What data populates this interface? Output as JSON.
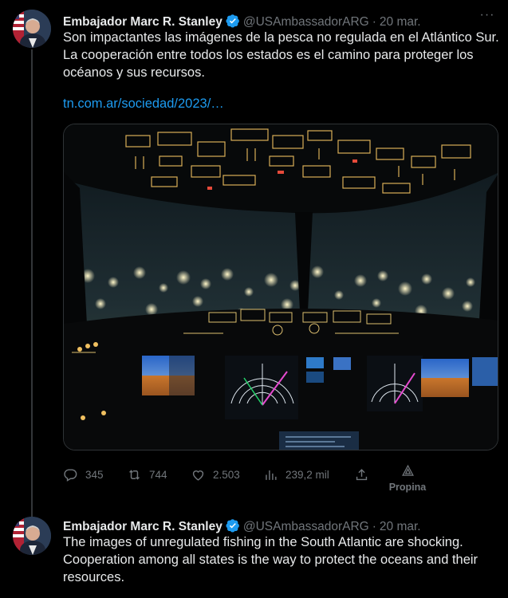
{
  "tweets": [
    {
      "author_name": "Embajador Marc R. Stanley",
      "handle": "@USAmbassadorARG",
      "date": "20 mar.",
      "text": "Son impactantes las imágenes de la pesca no regulada en el Atlántico Sur. La cooperación entre todos los estados es el camino para proteger los océanos y sus recursos.",
      "link": "tn.com.ar/sociedad/2023/…",
      "stats": {
        "replies": "345",
        "retweets": "744",
        "likes": "2.503",
        "views": "239,2 mil",
        "tip_label": "Propina"
      }
    },
    {
      "author_name": "Embajador Marc R. Stanley",
      "handle": "@USAmbassadorARG",
      "date": "20 mar.",
      "text": "The images of unregulated fishing in the South Atlantic are shocking. Cooperation among all states is the way to protect the oceans and their resources."
    }
  ],
  "icons": {
    "verified": "verified-badge-icon",
    "more": "more-options-icon",
    "reply": "reply-icon",
    "retweet": "retweet-icon",
    "like": "heart-icon",
    "views": "views-chart-icon",
    "share": "share-icon",
    "tip": "tip-icon"
  },
  "colors": {
    "background": "#000000",
    "text": "#e7e9ea",
    "secondary": "#71767b",
    "link": "#1d9bf0",
    "verified": "#1d9bf0"
  }
}
